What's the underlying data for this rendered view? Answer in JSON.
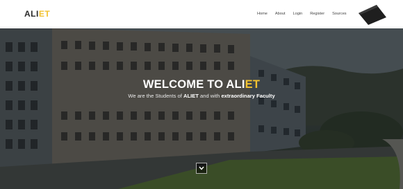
{
  "brand": {
    "prefix": "ALI",
    "accent": "ET"
  },
  "nav": {
    "items": [
      "Home",
      "About",
      "Login",
      "Register",
      "Sources"
    ]
  },
  "hero": {
    "title_prefix": "WELCOME TO ",
    "title_brand_prefix": "ALI",
    "title_brand_accent": "ET",
    "subtitle_part1": "We are the Students of ",
    "subtitle_bold1": "ALIET",
    "subtitle_part2": " and with ",
    "subtitle_bold2": "extraordinary Faculty"
  },
  "icons": {
    "scroll": "chevron-down-icon",
    "corner": "dark-ribbon-icon"
  },
  "colors": {
    "accent": "#f2c230",
    "navbar_bg": "#ffffff",
    "hero_overlay": "#141618"
  }
}
